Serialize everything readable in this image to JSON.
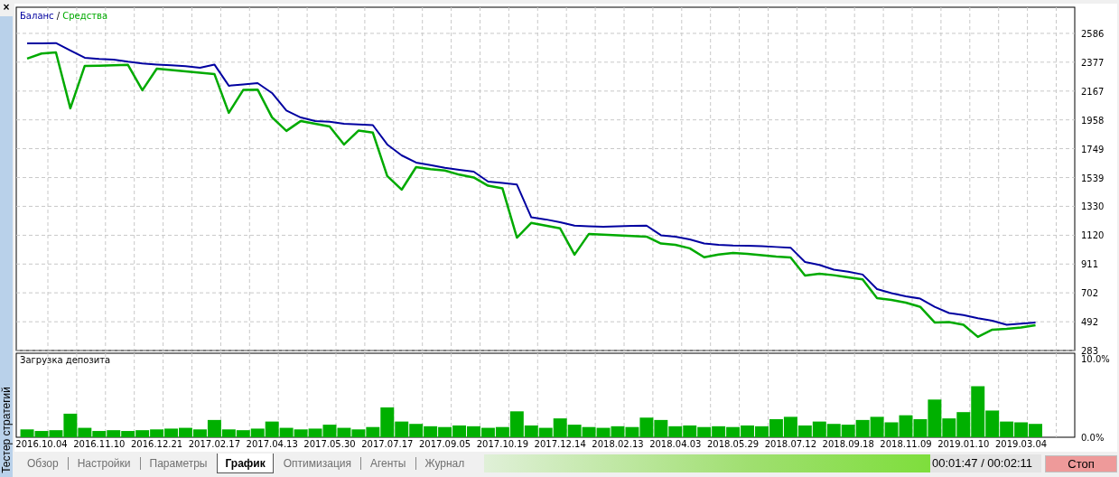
{
  "close_button": "×",
  "side_panel": {
    "title": "Тестер стратегий"
  },
  "balance_chart": {
    "legend_separator": "/",
    "chart_data": {
      "type": "line",
      "grid": true,
      "ylim": [
        283,
        2776
      ],
      "yticks": [
        2586,
        2377,
        2167,
        1958,
        1749,
        1539,
        1330,
        1120,
        911,
        702,
        492,
        283
      ],
      "categories": [
        null,
        null,
        null,
        null,
        null,
        null,
        null,
        null,
        null,
        null,
        null,
        null,
        null,
        null,
        null,
        null,
        null,
        null,
        null,
        null,
        null,
        null,
        null,
        null,
        null,
        null,
        null,
        null,
        null,
        null,
        null,
        null,
        null,
        null,
        null,
        null,
        null,
        null,
        null,
        null,
        null,
        null,
        null,
        null,
        null,
        null,
        null,
        null,
        null,
        null,
        null,
        null,
        null,
        null,
        null,
        null,
        null,
        null,
        null,
        null,
        null,
        null,
        null,
        null,
        null,
        null,
        null,
        null,
        null,
        null,
        null,
        null
      ],
      "series": [
        {
          "name": "Баланс",
          "color": "#0000a0",
          "values": [
            null,
            2514,
            2514,
            2516,
            2462,
            2409,
            2400,
            2396,
            2380,
            2367,
            2360,
            2355,
            2348,
            2336,
            2360,
            2206,
            2215,
            2225,
            2153,
            2025,
            1975,
            1950,
            1945,
            1930,
            1925,
            1920,
            1779,
            1700,
            1648,
            1630,
            1610,
            1595,
            1582,
            1510,
            1500,
            1488,
            1250,
            1235,
            1215,
            1190,
            1185,
            1182,
            1185,
            1188,
            1190,
            1120,
            1110,
            1090,
            1060,
            1050,
            1045,
            1044,
            1040,
            1035,
            1030,
            926,
            905,
            870,
            855,
            835,
            729,
            700,
            677,
            660,
            600,
            555,
            540,
            518,
            500,
            470,
            478,
            487
          ]
        },
        {
          "name": "Средства",
          "color": "#00aa00",
          "values": [
            null,
            2403,
            2440,
            2448,
            2042,
            2350,
            2352,
            2355,
            2357,
            2173,
            2330,
            2320,
            2310,
            2300,
            2291,
            2009,
            2175,
            2178,
            1976,
            1878,
            1950,
            1930,
            1910,
            1779,
            1880,
            1865,
            1550,
            1451,
            1615,
            1600,
            1590,
            1560,
            1540,
            1480,
            1460,
            1103,
            1210,
            1190,
            1170,
            979,
            1130,
            1125,
            1120,
            1115,
            1110,
            1060,
            1050,
            1025,
            960,
            980,
            992,
            985,
            975,
            965,
            959,
            828,
            840,
            830,
            815,
            800,
            664,
            650,
            631,
            600,
            487,
            490,
            470,
            382,
            434,
            440,
            450,
            467
          ]
        }
      ]
    }
  },
  "deposit_load_chart": {
    "chart_data": {
      "type": "bar",
      "title": "Загрузка депозита",
      "grid": true,
      "ylim": [
        0,
        10.7
      ],
      "yticks": [
        {
          "value": 10,
          "label": "10.0%"
        },
        {
          "value": 0,
          "label": "0.0%"
        }
      ],
      "categories": [
        null,
        null,
        "2016.10.04",
        null,
        null,
        null,
        "2016.11.10",
        null,
        null,
        null,
        "2016.12.21",
        null,
        null,
        null,
        "2017.02.17",
        null,
        null,
        null,
        "2017.04.13",
        null,
        null,
        null,
        "2017.05.30",
        null,
        null,
        null,
        "2017.07.17",
        null,
        null,
        null,
        "2017.09.05",
        null,
        null,
        null,
        "2017.10.19",
        null,
        null,
        null,
        "2017.12.14",
        null,
        null,
        null,
        "2018.02.13",
        null,
        null,
        null,
        "2018.04.03",
        null,
        null,
        null,
        "2018.05.29",
        null,
        null,
        null,
        "2018.07.12",
        null,
        null,
        null,
        "2018.09.18",
        null,
        null,
        null,
        "2018.11.09",
        null,
        null,
        null,
        "2019.01.10",
        null,
        null,
        null,
        "2019.03.04",
        null
      ],
      "values": [
        null,
        1.0,
        0.8,
        0.9,
        3.0,
        1.2,
        0.8,
        0.9,
        0.8,
        0.9,
        1.0,
        1.1,
        1.2,
        1.0,
        2.2,
        1.0,
        0.9,
        1.1,
        2.0,
        1.2,
        1.0,
        1.1,
        1.6,
        1.2,
        1.0,
        1.3,
        3.8,
        2.0,
        1.7,
        1.4,
        1.3,
        1.5,
        1.4,
        1.2,
        1.3,
        3.3,
        1.5,
        1.2,
        2.4,
        1.6,
        1.3,
        1.2,
        1.4,
        1.3,
        2.5,
        2.2,
        1.4,
        1.5,
        1.3,
        1.4,
        1.3,
        1.5,
        1.4,
        2.3,
        2.6,
        1.5,
        2.0,
        1.7,
        1.6,
        2.2,
        2.6,
        1.9,
        2.8,
        2.3,
        4.8,
        2.4,
        3.2,
        6.5,
        3.4,
        2.0,
        1.9,
        1.7
      ]
    }
  },
  "tabs": [
    {
      "label": "Обзор",
      "selected": false
    },
    {
      "label": "Настройки",
      "selected": false
    },
    {
      "label": "Параметры",
      "selected": false
    },
    {
      "label": "График",
      "selected": true
    },
    {
      "label": "Оптимизация",
      "selected": false
    },
    {
      "label": "Агенты",
      "selected": false
    },
    {
      "label": "Журнал",
      "selected": false
    }
  ],
  "progress": {
    "level": 0.8,
    "time": "00:01:47 / 00:02:11"
  },
  "stop_button": "Стоп"
}
